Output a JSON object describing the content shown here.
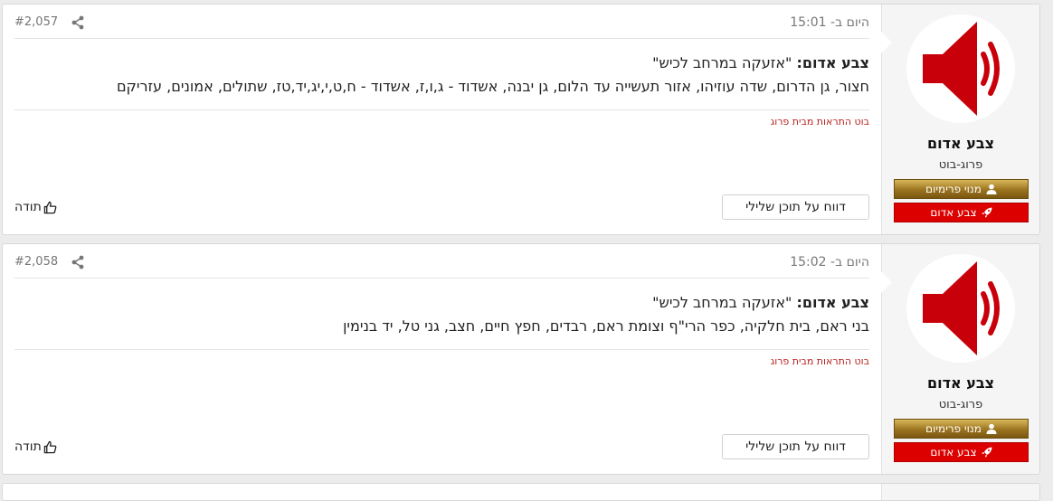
{
  "posts": [
    {
      "date": "היום ב- 15:01",
      "number": "#2,057",
      "title_prefix": "צבע אדום:",
      "title_rest": " \"אזעקה במרחב לכיש\"",
      "areas": "חצור, גן הדרום, שדה עוזיהו, אזור תעשייה עד הלום, גן יבנה, אשדוד - ג,ו,ז, אשדוד - ח,ט,י,יג,יד,טז, שתולים, אמונים, עזריקם",
      "signature": "בוט התראות מבית פרוג",
      "report_label": "דווח על תוכן שלילי",
      "thanks_label": "תודה",
      "author": {
        "name": "צבע אדום",
        "title": "פרוג-בוט",
        "badge_premium": "מנוי פרימיום",
        "badge_red": "צבע אדום"
      }
    },
    {
      "date": "היום ב- 15:02",
      "number": "#2,058",
      "title_prefix": "צבע אדום:",
      "title_rest": " \"אזעקה במרחב לכיש\"",
      "areas": "בני ראם, בית חלקיה, כפר הרי\"ף וצומת ראם, רבדים, חפץ חיים, חצב, גני טל, יד בנימין",
      "signature": "בוט התראות מבית פרוג",
      "report_label": "דווח על תוכן שלילי",
      "thanks_label": "תודה",
      "author": {
        "name": "צבע אדום",
        "title": "פרוג-בוט",
        "badge_premium": "מנוי פרימיום",
        "badge_red": "צבע אדום"
      }
    }
  ],
  "colors": {
    "avatar_red": "#c8000a",
    "signature": "#b22222",
    "red_badge": "#dd0000",
    "gold_badge": "#9c7420"
  },
  "icons": {
    "avatar": "speaker-icon",
    "share": "share-icon",
    "thanks": "thumbs-up-icon",
    "premium": "user-icon",
    "red_badge": "rocket-icon"
  }
}
